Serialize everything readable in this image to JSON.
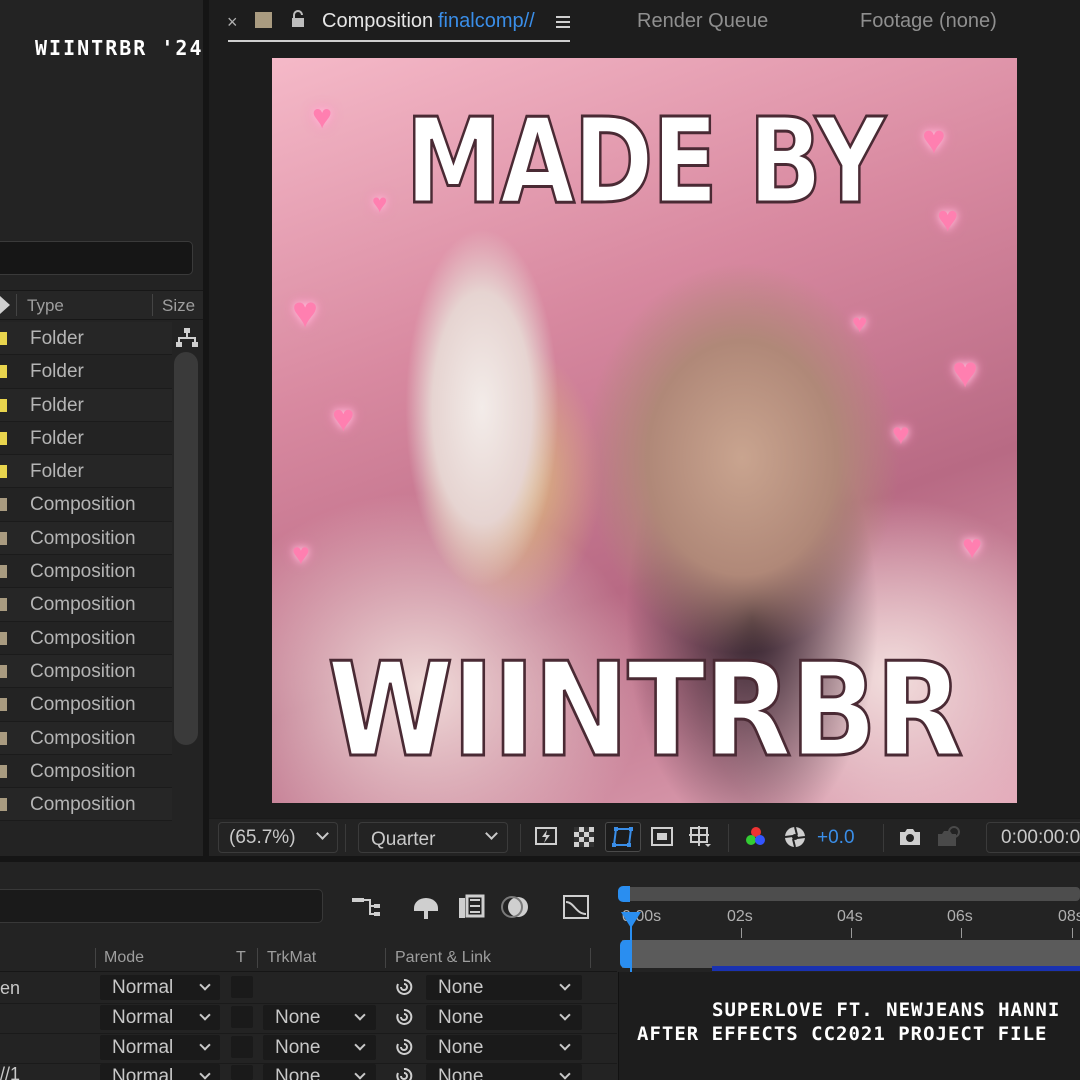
{
  "watermark": "WIINTRBR '24",
  "project": {
    "columns": {
      "type": "Type",
      "size": "Size"
    },
    "rows": [
      {
        "type": "Folder",
        "color": "#e8d44d"
      },
      {
        "type": "Folder",
        "color": "#e8d44d"
      },
      {
        "type": "Folder",
        "color": "#e8d44d"
      },
      {
        "type": "Folder",
        "color": "#e8d44d"
      },
      {
        "type": "Folder",
        "color": "#e8d44d"
      },
      {
        "type": "Composition",
        "color": "#a99b80"
      },
      {
        "type": "Composition",
        "color": "#a99b80"
      },
      {
        "type": "Composition",
        "color": "#a99b80"
      },
      {
        "type": "Composition",
        "color": "#a99b80"
      },
      {
        "type": "Composition",
        "color": "#a99b80"
      },
      {
        "type": "Composition",
        "color": "#a99b80"
      },
      {
        "type": "Composition",
        "color": "#a99b80"
      },
      {
        "type": "Composition",
        "color": "#a99b80"
      },
      {
        "type": "Composition",
        "color": "#a99b80"
      },
      {
        "type": "Composition",
        "color": "#a99b80"
      }
    ]
  },
  "comp_tabs": {
    "close": "×",
    "label": "Composition",
    "name": "finalcomp//",
    "render_queue": "Render Queue",
    "footage": "Footage  (none)"
  },
  "artwork": {
    "line1": "MADE BY",
    "line2": "WIINTRBR"
  },
  "viewer": {
    "zoom": "(65.7%)",
    "resolution": "Quarter",
    "exposure": "+0.0",
    "timecode": "0:00:00:0"
  },
  "timeline": {
    "headers": {
      "mode": "Mode",
      "t": "T",
      "trkmat": "TrkMat",
      "parent": "Parent & Link"
    },
    "rows": [
      {
        "name": "en",
        "mode": "Normal",
        "trkmat": "",
        "parent": "None"
      },
      {
        "name": "",
        "mode": "Normal",
        "trkmat": "None",
        "parent": "None"
      },
      {
        "name": "",
        "mode": "Normal",
        "trkmat": "None",
        "parent": "None"
      },
      {
        "name": "//1",
        "mode": "Normal",
        "trkmat": "None",
        "parent": "None"
      }
    ],
    "ruler": [
      "0:00s",
      "02s",
      "04s",
      "06s",
      "08s"
    ]
  },
  "caption": {
    "line1": "SUPERLOVE FT. NEWJEANS HANNI",
    "line2": "AFTER EFFECTS CC2021 PROJECT FILE"
  },
  "colors": {
    "accent_blue": "#3a8ee8",
    "folder_yellow": "#e8d44d",
    "comp_tan": "#a99b80"
  }
}
